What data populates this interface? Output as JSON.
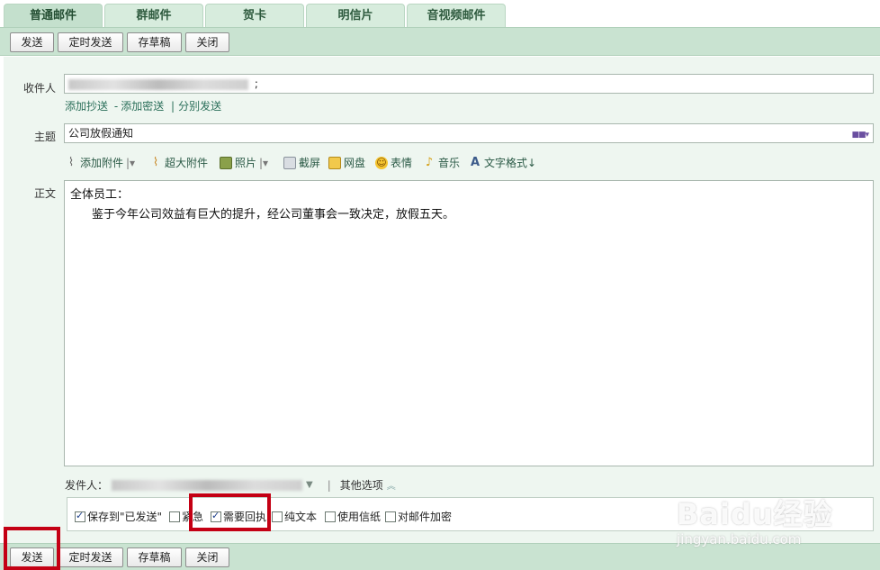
{
  "tabs": [
    {
      "label": "普通邮件"
    },
    {
      "label": "群邮件"
    },
    {
      "label": "贺卡"
    },
    {
      "label": "明信片"
    },
    {
      "label": "音视频邮件"
    }
  ],
  "toolbar": {
    "send": "发送",
    "scheduled_send": "定时发送",
    "save_draft": "存草稿",
    "close": "关闭"
  },
  "recipient": {
    "label": "收件人",
    "trailing": ";",
    "add_cc": "添加抄送",
    "dash": "-",
    "add_bcc": "添加密送",
    "separator": "|",
    "send_separately": "分别发送"
  },
  "subject": {
    "label": "主题",
    "value": "公司放假通知"
  },
  "format_toolbar": {
    "add_attachment": "添加附件",
    "large_attachment": "超大附件",
    "photo": "照片",
    "screenshot": "截屏",
    "netdisk": "网盘",
    "emoticon": "表情",
    "music": "音乐",
    "text_format": "文字格式↓"
  },
  "body": {
    "label": "正文",
    "line1": "全体员工：",
    "line2": "鉴于今年公司效益有巨大的提升，经公司董事会一致决定，放假五天。"
  },
  "sender": {
    "label": "发件人：",
    "separator": "|",
    "other_options": "其他选项"
  },
  "options": [
    {
      "label": "保存到\"已发送\"",
      "checked": true
    },
    {
      "label": "紧急",
      "checked": false
    },
    {
      "label": "需要回执",
      "checked": true
    },
    {
      "label": "纯文本",
      "checked": false
    },
    {
      "label": "使用信纸",
      "checked": false
    },
    {
      "label": "对邮件加密",
      "checked": false
    }
  ],
  "watermark": {
    "logo": "Baidu经验",
    "url": "jingyan.baidu.com"
  },
  "colors": {
    "toolbar_bg": "#c9e3d1",
    "tab_bg": "#d7ecdd",
    "link": "#2b6f5a",
    "highlight": "#c40014"
  }
}
